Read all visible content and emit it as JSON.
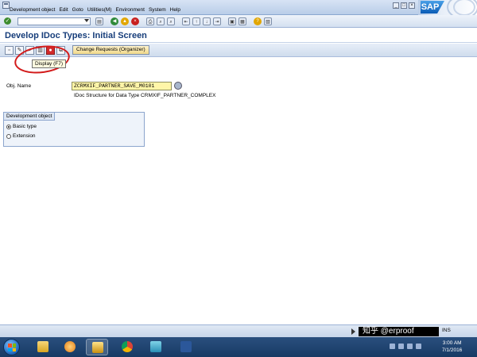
{
  "menubar": {
    "items": [
      "Development object",
      "Edit",
      "Goto",
      "Utilities(M)",
      "Environment",
      "System",
      "Help"
    ],
    "underlined": [
      "D",
      "E",
      "G",
      "U",
      "n",
      "S",
      "H"
    ]
  },
  "window_buttons": [
    "_",
    "□",
    "×"
  ],
  "logo": {
    "text": "SAP"
  },
  "title": "Develop IDoc Types: Initial Screen",
  "app_toolbar": {
    "change_requests_label": "Change Requests (Organizer)",
    "tooltip": "Display (F7)"
  },
  "form": {
    "obj_name_label": "Obj. Name",
    "obj_name_value": "ZCRMXIF_PARTNER_SAVE_M0101",
    "description": "IDoc Structure for Data Type CRMXIF_PARTNER_COMPLEX"
  },
  "development_object": {
    "title": "Development object",
    "options": [
      {
        "label": "Basic type",
        "selected": true
      },
      {
        "label": "Extension",
        "selected": false
      }
    ]
  },
  "statusbar": {
    "watermark": "知乎 @erproof",
    "mode": "INS"
  },
  "taskbar": {
    "time": "3:00 AM",
    "date": "7/1/2016"
  },
  "colors": {
    "title": "#163d7a",
    "highlight_circle": "#d31b1b",
    "input_required": "#fff5a8"
  }
}
